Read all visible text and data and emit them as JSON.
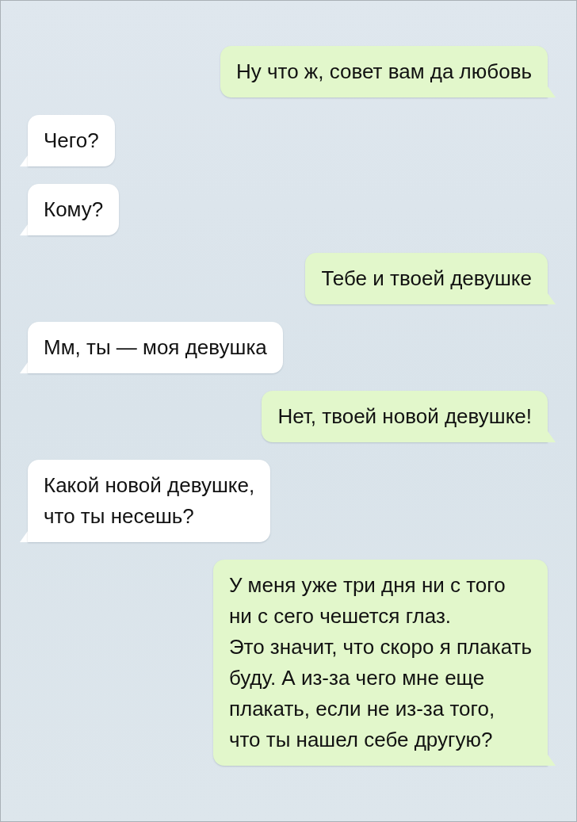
{
  "messages": [
    {
      "kind": "outgoing",
      "text": "Ну что ж, совет вам да любовь"
    },
    {
      "kind": "incoming",
      "text": "Чего?"
    },
    {
      "kind": "incoming",
      "text": "Кому?"
    },
    {
      "kind": "outgoing",
      "text": "Тебе и твоей девушке"
    },
    {
      "kind": "incoming",
      "text": "Мм, ты — моя девушка"
    },
    {
      "kind": "outgoing",
      "text": "Нет, твоей новой девушке!"
    },
    {
      "kind": "incoming",
      "text": "Какой новой девушке,\nчто ты несешь?"
    },
    {
      "kind": "outgoing",
      "text": "У меня уже три дня ни с того\nни с сего чешется глаз.\nЭто значит, что скоро я плакать\nбуду. А из-за чего мне еще\nплакать, если не из-за того,\nчто ты нашел себе другую?"
    }
  ]
}
